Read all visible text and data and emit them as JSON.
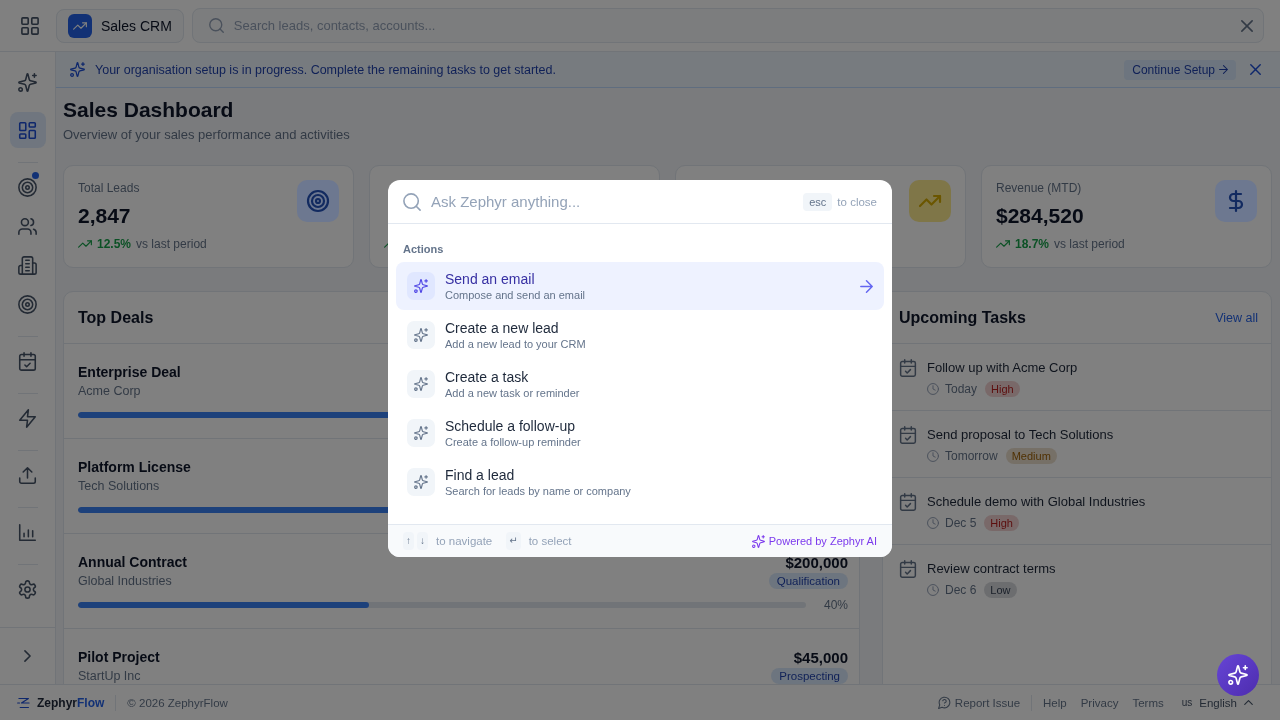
{
  "header": {
    "app_name": "Sales CRM",
    "search": {
      "placeholder": "Search leads, contacts, accounts..."
    }
  },
  "sidebar": {
    "groups": [
      {
        "items": [
          {
            "selected": false,
            "dot": false
          },
          {
            "selected": true,
            "dot": false
          }
        ]
      },
      {
        "items": [
          {
            "selected": false,
            "dot": true
          },
          {
            "selected": false,
            "dot": false
          },
          {
            "selected": false,
            "dot": false
          },
          {
            "selected": false,
            "dot": false
          }
        ]
      },
      {
        "items": [
          {
            "selected": false,
            "dot": false
          }
        ]
      },
      {
        "items": [
          {
            "selected": false,
            "dot": false
          }
        ]
      },
      {
        "items": [
          {
            "selected": false,
            "dot": false
          }
        ]
      },
      {
        "items": [
          {
            "selected": false,
            "dot": false
          }
        ]
      },
      {
        "items": [
          {
            "selected": false,
            "dot": false
          }
        ]
      }
    ]
  },
  "banner": {
    "message": "Your organisation setup is in progress. Complete the remaining tasks to get started.",
    "action": "Continue Setup"
  },
  "page": {
    "title": "Sales Dashboard",
    "subtitle": "Overview of your sales performance and activities"
  },
  "stats": [
    {
      "label": "Total Leads",
      "value": "2,847",
      "trend_up": true,
      "change": "12.5%",
      "note": "vs last period",
      "color": "#6d7890"
    },
    {
      "trend_up": true
    },
    {
      "color": "#7f7648"
    },
    {
      "label": "Revenue (MTD)",
      "value": "$284,520",
      "trend_up": true,
      "change": "18.7%",
      "note": "vs last period",
      "color": "#6d7890"
    }
  ],
  "top_deals": {
    "title": "Top Deals",
    "rows": [
      {
        "name": "Enterprise Deal",
        "company": "Acme Corp",
        "level": 0.75
      },
      {
        "name": "Platform License",
        "company": "Tech Solutions",
        "level": 0.6
      },
      {
        "name": "Annual Contract",
        "company": "Global Industries",
        "amount": "$200,000",
        "stage": "Qualification",
        "level": 0.4,
        "percent": "40%"
      },
      {
        "name": "Pilot Project",
        "company": "StartUp Inc",
        "amount": "$45,000",
        "stage": "Prospecting"
      }
    ]
  },
  "upcoming_tasks": {
    "title": "Upcoming Tasks",
    "link": "View all",
    "items": [
      {
        "title": "Follow up with Acme Corp",
        "due": "Today",
        "priority": "High",
        "color": "#5c0e0e"
      },
      {
        "title": "Send proposal to Tech Solutions",
        "due": "Tomorrow",
        "priority": "Medium",
        "color": "#503103"
      },
      {
        "title": "Schedule demo with Global Industries",
        "due": "Dec 5",
        "priority": "High",
        "color": "#5c0e0e"
      },
      {
        "title": "Review contract terms",
        "due": "Dec 6",
        "priority": "Low",
        "color": "#1a202a"
      }
    ]
  },
  "command_palette": {
    "placeholder": "Ask Zephyr anything...",
    "close_key": "esc",
    "close_hint": "to close",
    "section": "Actions",
    "items": [
      {
        "title": "Send an email",
        "description": "Compose and send an email",
        "selected": true
      },
      {
        "title": "Create a new lead",
        "description": "Add a new lead to your CRM",
        "selected": false
      },
      {
        "title": "Create a task",
        "description": "Add a new task or reminder",
        "selected": false
      },
      {
        "title": "Schedule a follow-up",
        "description": "Create a follow-up reminder",
        "selected": false
      },
      {
        "title": "Find a lead",
        "description": "Search for leads by name or company",
        "selected": false
      }
    ],
    "footer": {
      "navigate_keys": [
        "↑",
        "↓"
      ],
      "navigate_hint": "to navigate",
      "select_key": "↵",
      "select_hint": "to select",
      "powered_by": "Powered by Zephyr AI"
    }
  },
  "footer": {
    "brand": "Zephyr",
    "brand_accent": "Flow",
    "copyright": "© 2026 ZephyrFlow",
    "report": "Report Issue",
    "links": [
      "Help",
      "Privacy",
      "Terms"
    ],
    "flag": "us",
    "language": "English"
  }
}
